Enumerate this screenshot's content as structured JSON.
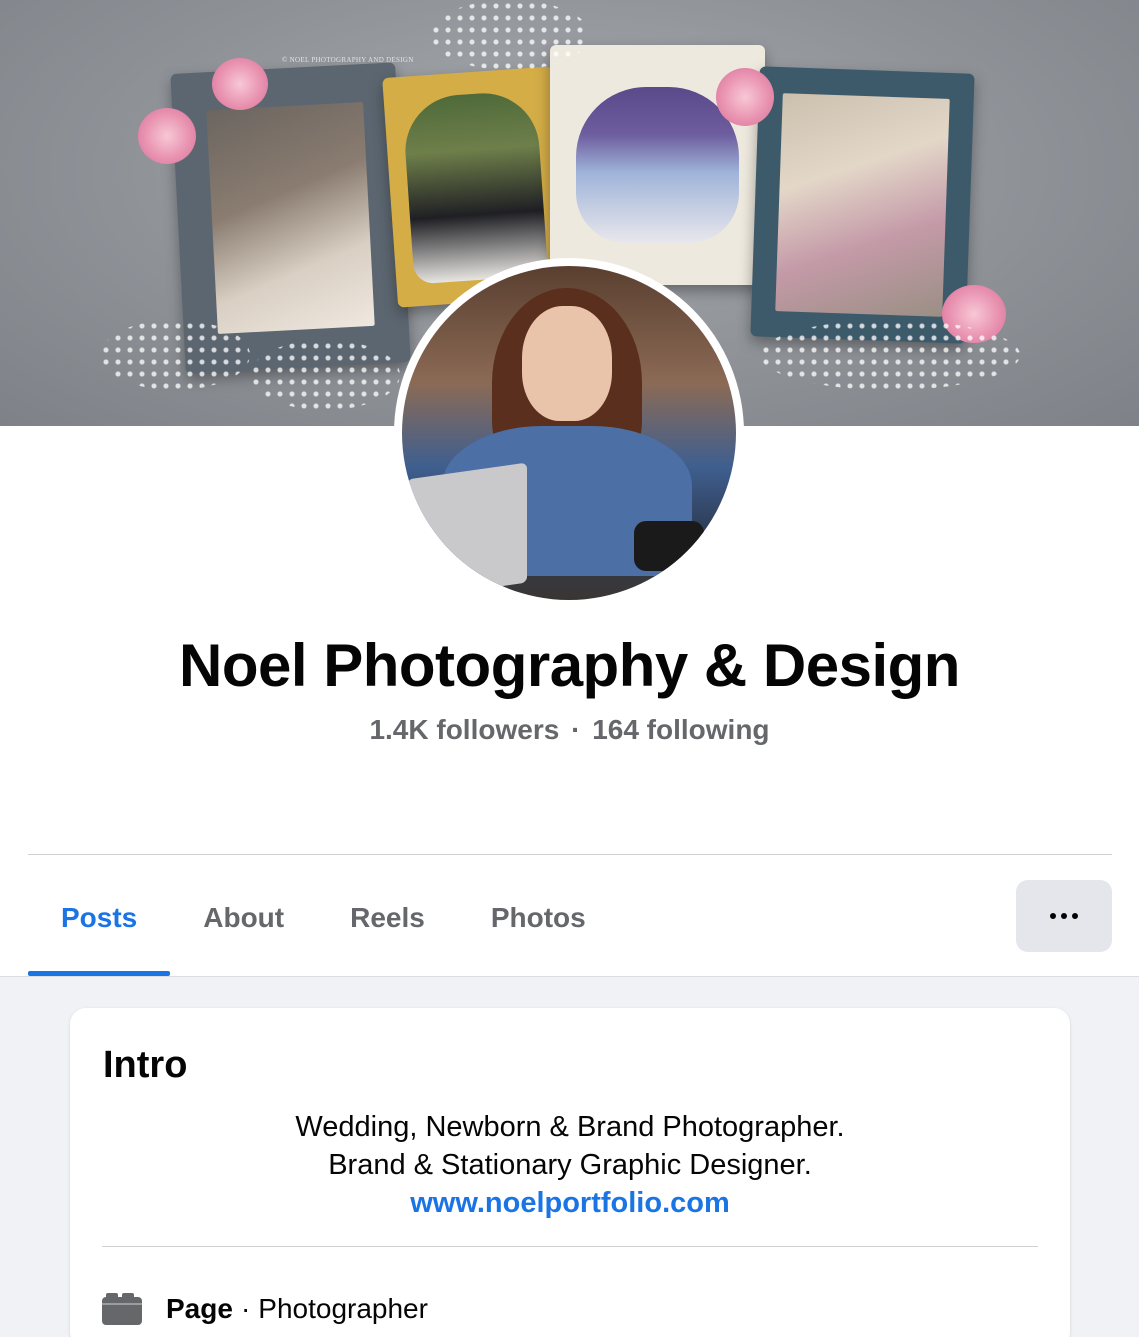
{
  "cover": {
    "watermark": "© NOEL PHOTOGRAPHY AND DESIGN"
  },
  "profile": {
    "name": "Noel Photography & Design",
    "followers": "1.4K followers",
    "separator": "·",
    "following": "164 following"
  },
  "tabs": [
    {
      "label": "Posts",
      "active": true
    },
    {
      "label": "About",
      "active": false
    },
    {
      "label": "Reels",
      "active": false
    },
    {
      "label": "Photos",
      "active": false
    }
  ],
  "more_button": {
    "icon": "more-horizontal-icon"
  },
  "intro": {
    "title": "Intro",
    "bio_line1": "Wedding, Newborn & Brand Photographer.",
    "bio_line2": "Brand & Stationary Graphic Designer.",
    "website": "www.noelportfolio.com",
    "page_type_label": "Page",
    "page_type_separator": "·",
    "page_category": "Photographer",
    "page_icon": "page-flag-icon"
  },
  "colors": {
    "accent": "#1b74e4",
    "secondary_text": "#65676b",
    "surface": "#f0f2f5",
    "button_bg": "#e4e6eb"
  }
}
